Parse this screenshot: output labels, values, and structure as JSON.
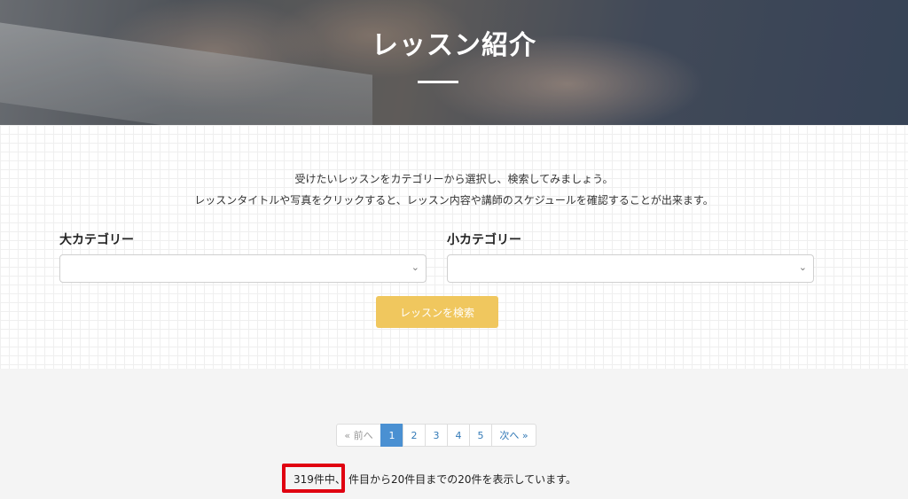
{
  "hero": {
    "title": "レッスン紹介"
  },
  "intro": {
    "line1": "受けたいレッスンをカテゴリーから選択し、検索してみましょう。",
    "line2": "レッスンタイトルや写真をクリックすると、レッスン内容や講師のスケジュールを確認することが出来ます。"
  },
  "filters": {
    "major_label": "大カテゴリー",
    "major_value": "",
    "minor_label": "小カテゴリー",
    "minor_value": "",
    "search_button": "レッスンを検索"
  },
  "pagination": {
    "prev": "« 前へ",
    "pages": [
      "1",
      "2",
      "3",
      "4",
      "5"
    ],
    "current": "1",
    "next": "次へ »"
  },
  "results": {
    "count_text": "319件中、",
    "range_text": "件目から20件目までの20件を表示しています。"
  },
  "colors": {
    "accent_button": "#f0c75e",
    "active_page": "#4a90d2",
    "highlight": "#e00010"
  }
}
